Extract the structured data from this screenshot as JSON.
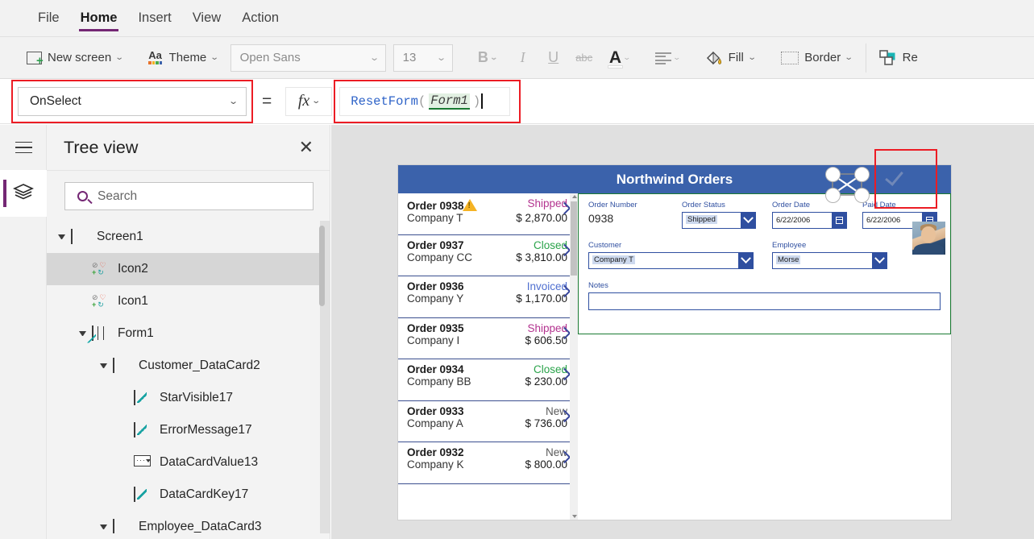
{
  "menu": {
    "items": [
      {
        "label": "File",
        "active": false
      },
      {
        "label": "Home",
        "active": true
      },
      {
        "label": "Insert",
        "active": false
      },
      {
        "label": "View",
        "active": false
      },
      {
        "label": "Action",
        "active": false
      }
    ]
  },
  "ribbon": {
    "new_screen": "New screen",
    "theme": "Theme",
    "font_name": "Open Sans",
    "font_size": "13",
    "bold": "B",
    "italic": "I",
    "underline": "U",
    "strikethrough": "abc",
    "font_color": "A",
    "align": "align",
    "fill": "Fill",
    "border": "Border",
    "reorder": "Re",
    "chevron": "⌄"
  },
  "formula_bar": {
    "property": "OnSelect",
    "equals": "=",
    "fx": "fx",
    "formula_parts": {
      "function": "ResetForm",
      "open_paren": "(",
      "identifier": "Form1",
      "close_paren": ")"
    },
    "formula_full": "ResetForm( Form1 )"
  },
  "tree_panel": {
    "title": "Tree view",
    "close": "✕",
    "search_placeholder": "Search",
    "nodes": [
      {
        "label": "Screen1",
        "indent": 0,
        "icon": "screen",
        "arrow": "open",
        "selected": false
      },
      {
        "label": "Icon2",
        "indent": 1,
        "icon": "icons",
        "arrow": "none",
        "selected": true
      },
      {
        "label": "Icon1",
        "indent": 1,
        "icon": "icons",
        "arrow": "none",
        "selected": false
      },
      {
        "label": "Form1",
        "indent": 1,
        "icon": "form",
        "arrow": "open",
        "selected": false
      },
      {
        "label": "Customer_DataCard2",
        "indent": 2,
        "icon": "card",
        "arrow": "open",
        "selected": false
      },
      {
        "label": "StarVisible17",
        "indent": 3,
        "icon": "edit",
        "arrow": "none",
        "selected": false
      },
      {
        "label": "ErrorMessage17",
        "indent": 3,
        "icon": "edit",
        "arrow": "none",
        "selected": false
      },
      {
        "label": "DataCardValue13",
        "indent": 3,
        "icon": "dropdown",
        "arrow": "none",
        "selected": false
      },
      {
        "label": "DataCardKey17",
        "indent": 3,
        "icon": "edit",
        "arrow": "none",
        "selected": false
      },
      {
        "label": "Employee_DataCard3",
        "indent": 2,
        "icon": "card",
        "arrow": "open",
        "selected": false
      }
    ]
  },
  "canvas": {
    "app_title": "Northwind Orders",
    "gallery": [
      {
        "order": "Order 0938",
        "company": "Company T",
        "status": "Shipped",
        "status_class": "st-shipped",
        "amount": "$ 2,870.00",
        "warning": true
      },
      {
        "order": "Order 0937",
        "company": "Company CC",
        "status": "Closed",
        "status_class": "st-closed",
        "amount": "$ 3,810.00",
        "warning": false
      },
      {
        "order": "Order 0936",
        "company": "Company Y",
        "status": "Invoiced",
        "status_class": "st-invoiced",
        "amount": "$ 1,170.00",
        "warning": false
      },
      {
        "order": "Order 0935",
        "company": "Company I",
        "status": "Shipped",
        "status_class": "st-shipped",
        "amount": "$ 606.50",
        "warning": false
      },
      {
        "order": "Order 0934",
        "company": "Company BB",
        "status": "Closed",
        "status_class": "st-closed",
        "amount": "$ 230.00",
        "warning": false
      },
      {
        "order": "Order 0933",
        "company": "Company A",
        "status": "New",
        "status_class": "st-new",
        "amount": "$ 736.00",
        "warning": false
      },
      {
        "order": "Order 0932",
        "company": "Company K",
        "status": "New",
        "status_class": "st-new",
        "amount": "$ 800.00",
        "warning": false
      }
    ],
    "form": {
      "order_number_label": "Order Number",
      "order_number_value": "0938",
      "order_status_label": "Order Status",
      "order_status_value": "Shipped",
      "order_date_label": "Order Date",
      "order_date_value": "6/22/2006",
      "paid_date_label": "Paid Date",
      "paid_date_value": "6/22/2006",
      "customer_label": "Customer",
      "customer_value": "Company T",
      "employee_label": "Employee",
      "employee_value": "Morse",
      "notes_label": "Notes",
      "notes_value": ""
    }
  },
  "colors": {
    "accent_purple": "#742774",
    "highlight_red": "#ec1c24",
    "app_blue": "#3b62ab",
    "form_green": "#1a7a32",
    "control_blue": "#2f4fa0"
  }
}
